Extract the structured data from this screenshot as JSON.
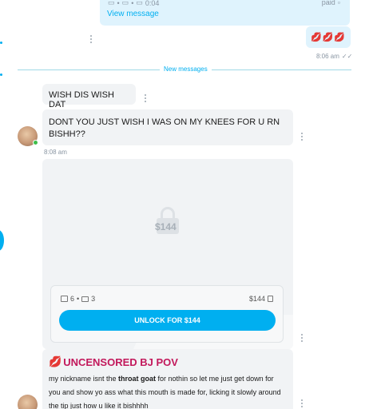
{
  "sent_top": {
    "meta_time": "0:04",
    "paid_label": "paid",
    "view_message": "View message"
  },
  "sent_lips": {
    "emoji": "💋💋💋",
    "time": "8:06 am"
  },
  "divider": {
    "label": "New messages"
  },
  "messages": [
    {
      "text": "WISH DIS WISH DAT"
    },
    {
      "text": "DONT YOU JUST WISH I WAS ON MY KNEES FOR U RN BISHH??",
      "time": "8:08 am"
    }
  ],
  "media": {
    "price_overlay": "$144",
    "images_count": "6",
    "videos_count": "3",
    "price": "$144",
    "unlock_label": "UNLOCK FOR $144"
  },
  "caption": {
    "title_emoji": "💋",
    "title": "UNCENSORED BJ POV",
    "text_before": "my nickname isnt the ",
    "text_bold": "throat goat",
    "text_after": " for nothin so let me just get down for you and show yo ass what this mouth is made for, licking it slowly around the tip just how u like it bishhhh"
  },
  "colors": {
    "accent": "#00aff0",
    "sent_bubble": "#dff3fd",
    "received_bubble": "#f1f3f5",
    "caption_title": "#c2185b"
  }
}
